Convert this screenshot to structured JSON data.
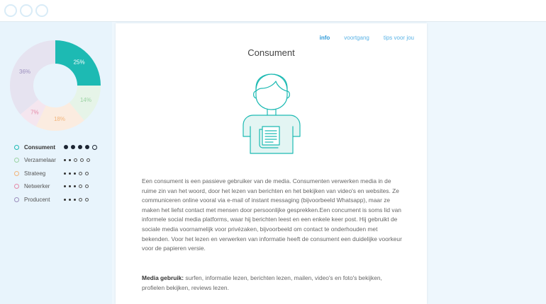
{
  "chart_data": {
    "type": "pie",
    "categories": [
      "Consument",
      "Verzamelaar",
      "Strateeg",
      "Netwerker",
      "Producent"
    ],
    "values": [
      25,
      14,
      18,
      7,
      36
    ],
    "labels": [
      "25%",
      "14%",
      "18%",
      "7%",
      "36%"
    ],
    "colors": [
      "#1dbab3",
      "#e6f4e8",
      "#fbece0",
      "#f5e6ef",
      "#e6e3f0"
    ],
    "label_colors": [
      "#ffffff",
      "#9cd3a4",
      "#f2b57b",
      "#e58aa8",
      "#9b8fbd"
    ]
  },
  "legend": {
    "items": [
      {
        "label": "Consument",
        "ring_color": "#1dbab3",
        "active": true
      },
      {
        "label": "Verzamelaar",
        "ring_color": "#9cd3a4",
        "active": false
      },
      {
        "label": "Strateeg",
        "ring_color": "#f2b57b",
        "active": false
      },
      {
        "label": "Netwerker",
        "ring_color": "#e58aa8",
        "active": false
      },
      {
        "label": "Producent",
        "ring_color": "#9b8fbd",
        "active": false
      }
    ]
  },
  "tabs": [
    {
      "label": "info",
      "active": true
    },
    {
      "label": "voortgang",
      "active": false
    },
    {
      "label": "tips voor jou",
      "active": false
    }
  ],
  "card": {
    "title": "Consument",
    "description": "Een consument is een passieve gebruiker van de media. Consumenten verwerken media in de ruime zin van het woord, door het lezen van berichten en het bekijken van video's en websites. Ze communiceren online vooral via e-mail of instant messaging (bijvoorbeeld Whatsapp), maar ze maken het liefst contact met mensen door persoonlijke gesprekken.Een concument is soms lid van informele social media platforms, waar hij berichten leest en een enkele keer post. Hij gebruikt de sociale media voornamelijk voor privézaken, bijvoorbeeld om contact te onderhouden met bekenden. Voor het lezen en verwerken van informatie heeft de consument een duidelijke voorkeur voor de papieren versie.",
    "media_label": "Media gebruik:",
    "media_text": " surfen, informatie lezen, berichten lezen, mailen, video's en foto's bekijken, profielen bekijken, reviews lezen."
  },
  "illustration": {
    "icon": "consumer-person-icon",
    "accent": "#1dbab3"
  }
}
